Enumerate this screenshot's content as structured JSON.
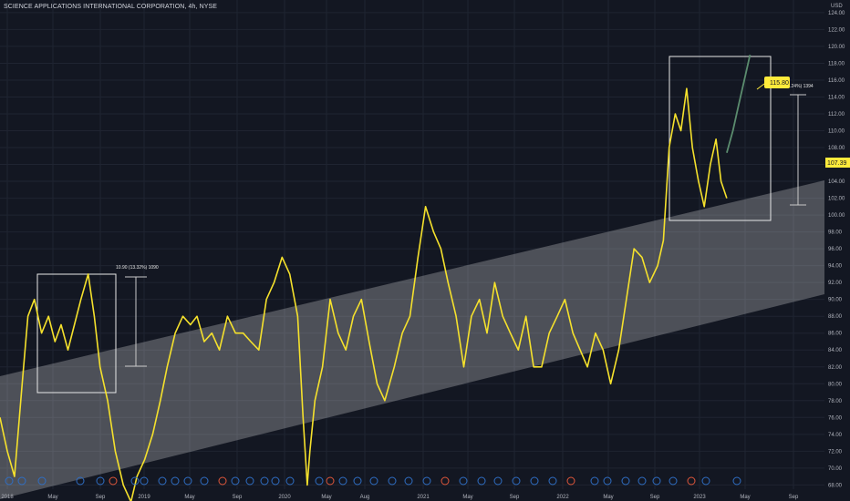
{
  "header": {
    "title": "SCIENCE APPLICATIONS INTERNATIONAL CORPORATION, 4h, NYSE",
    "currency": "USD"
  },
  "price_tags": {
    "current": "107.39",
    "target": "115.80"
  },
  "measurements": [
    {
      "label": "10.90 (13.32%) 1090"
    },
    {
      "label": "13.90 (13.24%) 1394"
    }
  ],
  "chart_data": {
    "type": "line",
    "title": "SCIENCE APPLICATIONS INTERNATIONAL CORPORATION, 4h, NYSE",
    "ylabel": "USD",
    "ylim": [
      67.5,
      125.5
    ],
    "y_ticks": [
      68,
      70,
      72,
      74,
      76,
      78,
      80,
      82,
      84,
      86,
      88,
      90,
      92,
      94,
      96,
      98,
      100,
      102,
      104,
      106,
      108,
      110,
      112,
      114,
      116,
      118,
      120,
      122,
      124
    ],
    "x_tick_labels": [
      "2018",
      "May",
      "Sep",
      "2019",
      "May",
      "Sep",
      "2020",
      "May",
      "Aug",
      "2021",
      "May",
      "Sep",
      "2022",
      "May",
      "Sep",
      "2023",
      "May",
      "Sep"
    ],
    "xlim": [
      "2018-01-01",
      "2023-12-01"
    ],
    "grid": true,
    "colors": {
      "price": "#f5e12c",
      "projection": "#5b8c6e",
      "channel": "#ffffff",
      "box": "#e8e8e8",
      "tag_bg": "#ffeb3b",
      "tag_text": "#131722"
    },
    "series": [
      {
        "x": [
          "2018-01-01",
          "2018-01-20",
          "2018-02-08",
          "2018-02-28",
          "2018-03-15",
          "2018-04-01",
          "2018-04-20",
          "2018-05-08",
          "2018-05-25",
          "2018-06-10",
          "2018-06-28",
          "2018-07-15",
          "2018-08-01",
          "2018-08-20",
          "2018-09-05",
          "2018-09-20",
          "2018-10-10",
          "2018-10-30",
          "2018-11-20",
          "2018-12-10",
          "2018-12-26",
          "2019-01-15",
          "2019-02-05",
          "2019-02-25",
          "2019-03-15",
          "2019-04-05",
          "2019-04-25",
          "2019-05-15",
          "2019-06-01",
          "2019-06-20",
          "2019-07-10",
          "2019-07-30",
          "2019-08-20",
          "2019-09-10",
          "2019-09-30",
          "2019-10-20",
          "2019-11-10",
          "2019-11-30",
          "2019-12-20",
          "2020-01-10",
          "2020-01-30",
          "2020-02-20",
          "2020-03-05",
          "2020-03-16",
          "2020-03-23",
          "2020-04-05",
          "2020-04-25",
          "2020-05-15",
          "2020-06-05",
          "2020-06-25",
          "2020-07-15",
          "2020-08-05",
          "2020-08-25",
          "2020-09-15",
          "2020-10-05",
          "2020-10-30",
          "2020-11-20",
          "2020-12-10",
          "2020-12-31",
          "2021-01-20",
          "2021-02-10",
          "2021-03-01",
          "2021-03-20",
          "2021-04-10",
          "2021-04-30",
          "2021-05-20",
          "2021-06-10",
          "2021-06-30",
          "2021-07-20",
          "2021-08-10",
          "2021-08-30",
          "2021-09-20",
          "2021-10-10",
          "2021-10-30",
          "2021-11-20",
          "2021-12-10",
          "2021-12-31",
          "2022-01-20",
          "2022-02-10",
          "2022-03-01",
          "2022-03-20",
          "2022-04-10",
          "2022-04-30",
          "2022-05-20",
          "2022-06-10",
          "2022-06-30",
          "2022-07-20",
          "2022-08-10",
          "2022-08-30",
          "2022-09-20",
          "2022-10-05",
          "2022-10-20",
          "2022-11-05",
          "2022-11-20",
          "2022-12-05",
          "2022-12-20",
          "2023-01-05",
          "2023-01-20",
          "2023-02-05",
          "2023-02-20",
          "2023-03-05",
          "2023-03-20"
        ],
        "y": [
          76,
          72,
          69,
          80,
          88,
          90,
          86,
          88,
          85,
          87,
          84,
          87,
          90,
          93,
          88,
          82,
          78,
          72,
          68,
          66,
          69,
          71,
          74,
          78,
          82,
          86,
          88,
          87,
          88,
          85,
          86,
          84,
          88,
          86,
          86,
          85,
          84,
          90,
          92,
          95,
          93,
          88,
          76,
          68,
          72,
          78,
          82,
          90,
          86,
          84,
          88,
          90,
          85,
          80,
          78,
          82,
          86,
          88,
          95,
          101,
          98,
          96,
          92,
          88,
          82,
          88,
          90,
          86,
          92,
          88,
          86,
          84,
          88,
          82,
          82,
          86,
          88,
          90,
          86,
          84,
          82,
          86,
          84,
          80,
          84,
          90,
          96,
          95,
          92,
          94,
          97,
          108,
          112,
          110,
          115,
          108,
          104,
          101,
          106,
          109,
          104,
          102
        ]
      },
      {
        "name": "",
        "x": [
          "2023-03-20",
          "2023-04-05",
          "2023-04-20",
          "2023-05-05",
          "2023-05-20"
        ],
        "y": [
          107.39,
          110,
          113,
          116,
          119
        ]
      }
    ]
  }
}
